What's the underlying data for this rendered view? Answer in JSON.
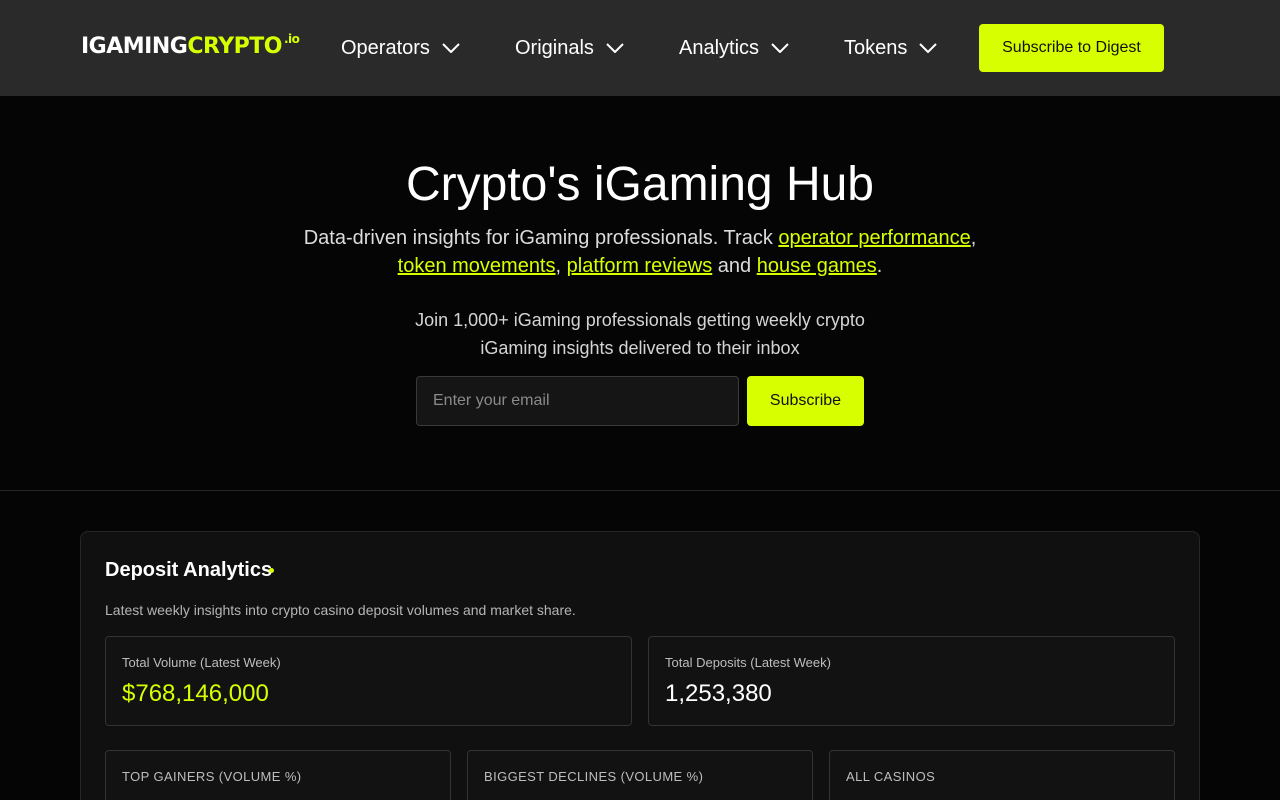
{
  "nav": {
    "logo": {
      "word_white": "IGAMING",
      "word_accent": "CRYPTO",
      "suffix": ".io"
    },
    "items": [
      {
        "label": "Operators",
        "icon": "chevron-down-icon"
      },
      {
        "label": "Originals",
        "icon": "chevron-down-icon"
      },
      {
        "label": "Analytics",
        "icon": "chevron-down-icon"
      },
      {
        "label": "Tokens",
        "icon": "chevron-down-icon"
      }
    ],
    "cta_label": "Subscribe to Digest"
  },
  "hero": {
    "title": "Crypto's iGaming Hub",
    "subtitle_prefix": "Data-driven insights for iGaming professionals. Track ",
    "links": [
      "operator performance",
      "token movements",
      "platform reviews",
      "house games"
    ],
    "sep_comma": ",",
    "sep_and": " and ",
    "sep_period": ".",
    "join_text": "Join 1,000+ iGaming professionals getting weekly crypto iGaming insights delivered to their inbox",
    "email_placeholder": "Enter your email",
    "subscribe_label": "Subscribe"
  },
  "analytics": {
    "title": "Deposit Analytics",
    "description": "Latest weekly insights into crypto casino deposit volumes and market share.",
    "total_volume": {
      "label": "Total Volume (Latest Week)",
      "value": "$768,146,000"
    },
    "total_deposits": {
      "label": "Total Deposits (Latest Week)",
      "value": "1,253,380"
    },
    "cards": [
      "TOP GAINERS (VOLUME %)",
      "BIGGEST DECLINES (VOLUME %)",
      "ALL CASINOS"
    ]
  },
  "colors": {
    "accent": "#d8ff00",
    "navbar": "#2a2a2a",
    "background": "#050505"
  }
}
